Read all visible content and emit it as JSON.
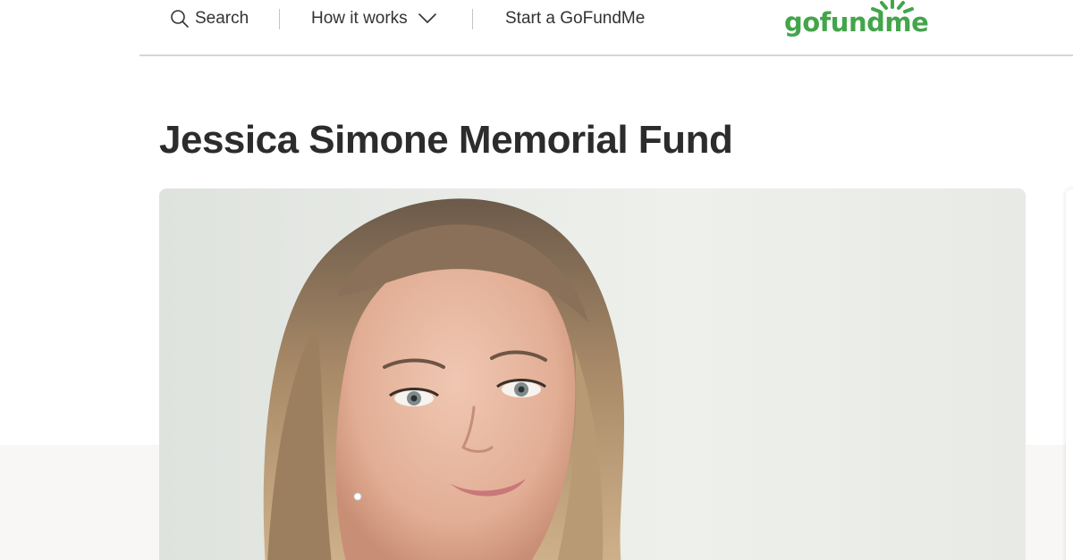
{
  "header": {
    "search_label": "Search",
    "how_it_works_label": "How it works",
    "start_label": "Start a GoFundMe",
    "logo_text": "gofundme"
  },
  "campaign": {
    "title": "Jessica Simone Memorial Fund",
    "photo_description": "campaign-photo"
  },
  "colors": {
    "brand_green": "#43a54a",
    "text": "#333333",
    "title": "#2c2c2c",
    "divider": "#d5d5d5"
  },
  "icons": {
    "search": "search-icon",
    "chevron": "chevron-down-icon",
    "logo_burst": "logo-burst-icon"
  }
}
